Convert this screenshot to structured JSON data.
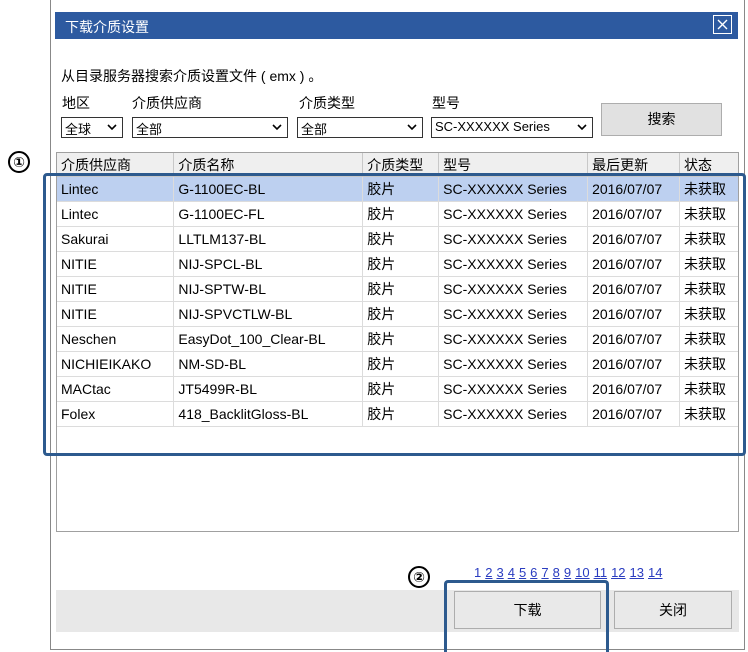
{
  "window": {
    "title": "下载介质设置",
    "description": "从目录服务器搜索介质设置文件 ( emx ) 。"
  },
  "filters": {
    "region": {
      "label": "地区",
      "value": "全球"
    },
    "vendor": {
      "label": "介质供应商",
      "value": "全部"
    },
    "media_type": {
      "label": "介质类型",
      "value": "全部"
    },
    "model": {
      "label": "型号",
      "value": "SC-XXXXXX Series"
    },
    "search_label": "搜索"
  },
  "table": {
    "headers": [
      "介质供应商",
      "介质名称",
      "介质类型",
      "型号",
      "最后更新",
      "状态"
    ],
    "rows": [
      [
        "Lintec",
        "G-1100EC-BL",
        "胶片",
        "SC-XXXXXX Series",
        "2016/07/07",
        "未获取"
      ],
      [
        "Lintec",
        "G-1100EC-FL",
        "胶片",
        "SC-XXXXXX Series",
        "2016/07/07",
        "未获取"
      ],
      [
        "Sakurai",
        "LLTLM137-BL",
        "胶片",
        "SC-XXXXXX Series",
        "2016/07/07",
        "未获取"
      ],
      [
        "NITIE",
        "NIJ-SPCL-BL",
        "胶片",
        "SC-XXXXXX Series",
        "2016/07/07",
        "未获取"
      ],
      [
        "NITIE",
        "NIJ-SPTW-BL",
        "胶片",
        "SC-XXXXXX Series",
        "2016/07/07",
        "未获取"
      ],
      [
        "NITIE",
        "NIJ-SPVCTLW-BL",
        "胶片",
        "SC-XXXXXX Series",
        "2016/07/07",
        "未获取"
      ],
      [
        "Neschen",
        "EasyDot_100_Clear-BL",
        "胶片",
        "SC-XXXXXX Series",
        "2016/07/07",
        "未获取"
      ],
      [
        "NICHIEIKAKO",
        "NM-SD-BL",
        "胶片",
        "SC-XXXXXX Series",
        "2016/07/07",
        "未获取"
      ],
      [
        "MACtac",
        "JT5499R-BL",
        "胶片",
        "SC-XXXXXX Series",
        "2016/07/07",
        "未获取"
      ],
      [
        "Folex",
        "418_BacklitGloss-BL",
        "胶片",
        "SC-XXXXXX Series",
        "2016/07/07",
        "未获取"
      ]
    ]
  },
  "pagination": {
    "pages": [
      "1",
      "2",
      "3",
      "4",
      "5",
      "6",
      "7",
      "8",
      "9",
      "10",
      "11",
      "12",
      "13",
      "14"
    ],
    "current": "1"
  },
  "buttons": {
    "download": "下载",
    "close": "关闭"
  },
  "callouts": {
    "one": "①",
    "two": "②"
  },
  "colors": {
    "titlebar": "#2d5aa0",
    "selected_row": "#bdd0f0",
    "callout": "#2d5a8e"
  }
}
